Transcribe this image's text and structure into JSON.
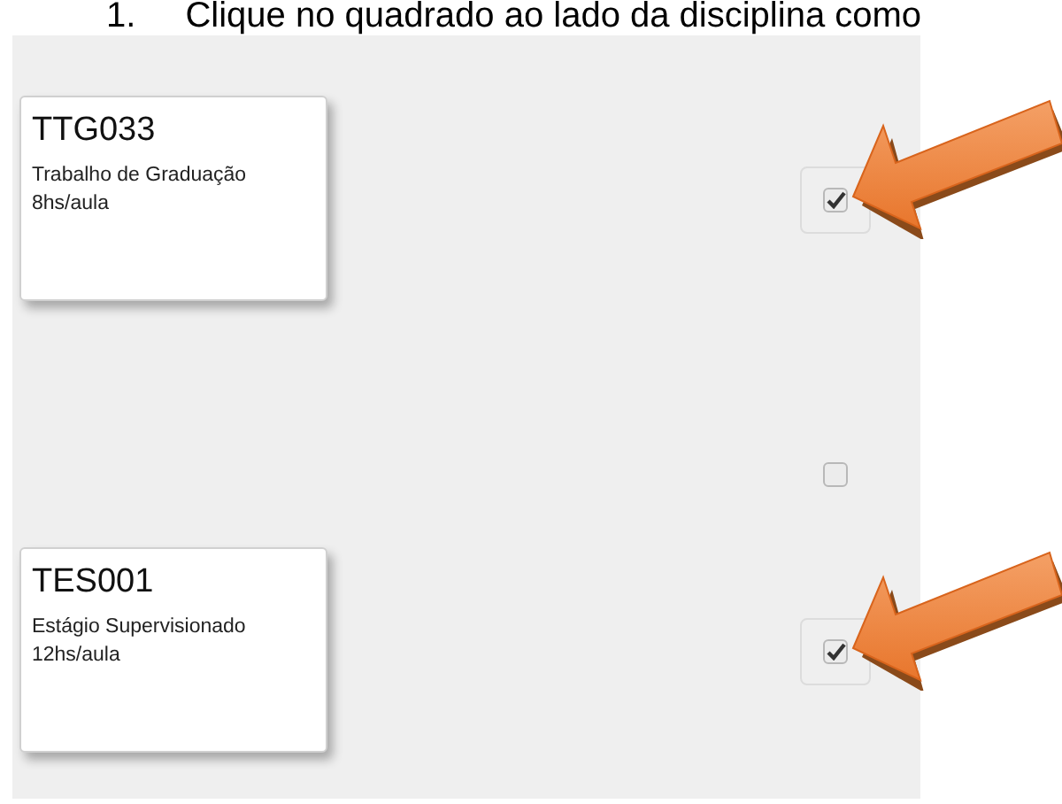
{
  "instruction": {
    "number": "1.",
    "text": "Clique no quadrado ao lado da disciplina como"
  },
  "rows": [
    {
      "kind": "course",
      "code": "TTG033",
      "name": "Trabalho de Graduação",
      "hours": "8hs/aula",
      "checked": true,
      "arrow": true
    },
    {
      "kind": "blank",
      "checked": false,
      "arrow": false
    },
    {
      "kind": "course",
      "code": "TES001",
      "name": "Estágio Supervisionado",
      "hours": "12hs/aula",
      "checked": true,
      "arrow": true
    }
  ]
}
